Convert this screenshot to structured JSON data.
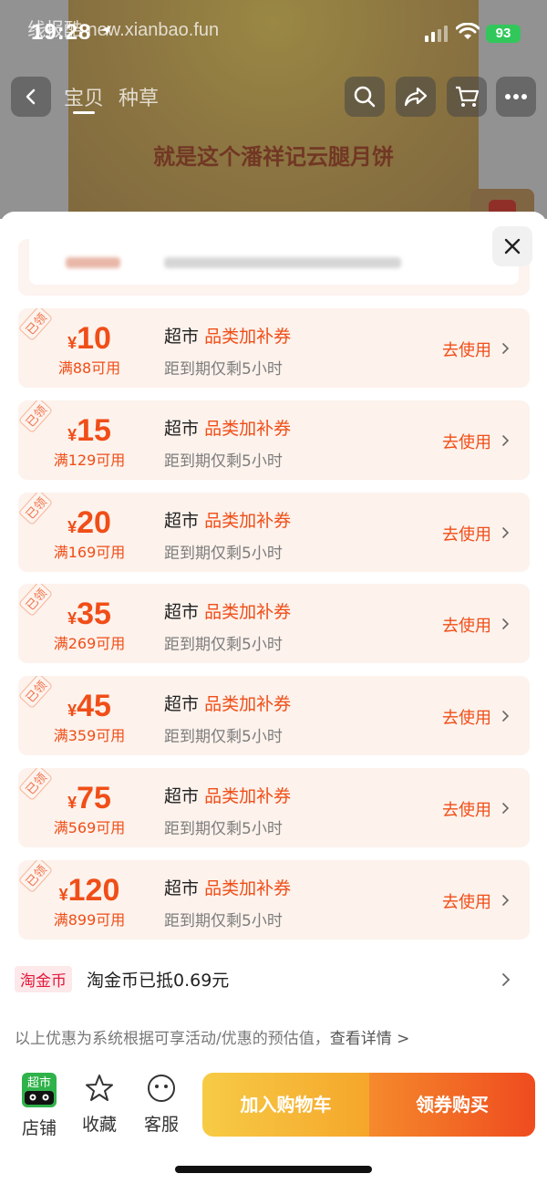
{
  "status_bar": {
    "time": "19:28",
    "battery": "93",
    "watermark": "线报酷 new.xianbao.fun"
  },
  "nav": {
    "tabs": [
      "宝贝",
      "种草"
    ]
  },
  "poster": {
    "text": "就是这个潘祥记云腿月饼"
  },
  "coupons": [
    {
      "stamp": "已领",
      "yen": "¥",
      "amount": "10",
      "condition": "满88可用",
      "title_prefix": "超市",
      "title_highlight": "品类加补券",
      "expiry": "距到期仅剩5小时",
      "action": "去使用"
    },
    {
      "stamp": "已领",
      "yen": "¥",
      "amount": "15",
      "condition": "满129可用",
      "title_prefix": "超市",
      "title_highlight": "品类加补券",
      "expiry": "距到期仅剩5小时",
      "action": "去使用"
    },
    {
      "stamp": "已领",
      "yen": "¥",
      "amount": "20",
      "condition": "满169可用",
      "title_prefix": "超市",
      "title_highlight": "品类加补券",
      "expiry": "距到期仅剩5小时",
      "action": "去使用"
    },
    {
      "stamp": "已领",
      "yen": "¥",
      "amount": "35",
      "condition": "满269可用",
      "title_prefix": "超市",
      "title_highlight": "品类加补券",
      "expiry": "距到期仅剩5小时",
      "action": "去使用"
    },
    {
      "stamp": "已领",
      "yen": "¥",
      "amount": "45",
      "condition": "满359可用",
      "title_prefix": "超市",
      "title_highlight": "品类加补券",
      "expiry": "距到期仅剩5小时",
      "action": "去使用"
    },
    {
      "stamp": "已领",
      "yen": "¥",
      "amount": "75",
      "condition": "满569可用",
      "title_prefix": "超市",
      "title_highlight": "品类加补券",
      "expiry": "距到期仅剩5小时",
      "action": "去使用"
    },
    {
      "stamp": "已领",
      "yen": "¥",
      "amount": "120",
      "condition": "满899可用",
      "title_prefix": "超市",
      "title_highlight": "品类加补券",
      "expiry": "距到期仅剩5小时",
      "action": "去使用"
    }
  ],
  "coin": {
    "tag": "淘金币",
    "text": "淘金币已抵0.69元"
  },
  "disclaimer": {
    "text": "以上优惠为系统根据可享活动/优惠的预估值，",
    "link": "查看详情 >"
  },
  "bottom_bar": {
    "store_badge": "超市",
    "store": "店铺",
    "favorite": "收藏",
    "service": "客服",
    "add_cart": "加入购物车",
    "buy": "领券购买"
  },
  "colors": {
    "accent": "#f04e18",
    "coupon_bg": "#fdf2ec",
    "cart_btn": "#f6b83a",
    "buy_btn": "#f06a24"
  }
}
